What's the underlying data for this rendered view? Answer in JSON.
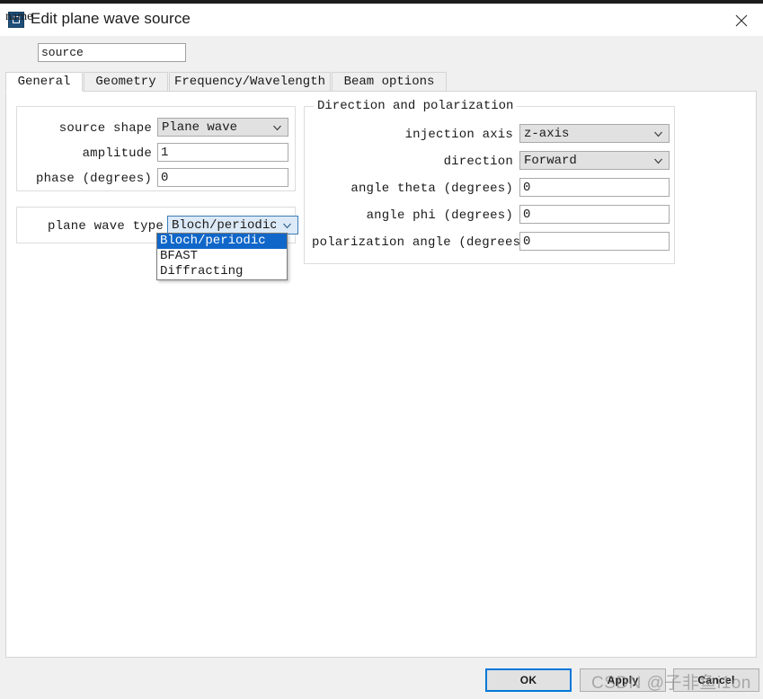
{
  "window": {
    "title": "Edit plane wave source",
    "icon": "app-window-icon",
    "close_icon": "close-icon"
  },
  "name_field": {
    "label": "name",
    "value": "source",
    "placeholder": ""
  },
  "tabs": [
    {
      "label": "General",
      "active": true
    },
    {
      "label": "Geometry",
      "active": false
    },
    {
      "label": "Frequency/Wavelength",
      "active": false
    },
    {
      "label": "Beam options",
      "active": false
    }
  ],
  "general": {
    "source_group": {
      "legend": "",
      "fields": [
        {
          "label": "source shape",
          "type": "combo",
          "value": "Plane wave"
        },
        {
          "label": "amplitude",
          "type": "text",
          "value": "1"
        },
        {
          "label": "phase (degrees)",
          "type": "text",
          "value": "0"
        }
      ]
    },
    "plane_wave_group": {
      "legend": "",
      "field": {
        "label": "plane wave type",
        "type": "combo",
        "value": "Bloch/periodic"
      },
      "dropdown": {
        "open": true,
        "options": [
          "Bloch/periodic",
          "BFAST",
          "Diffracting"
        ],
        "selected_index": 0
      }
    },
    "direction_group": {
      "legend": "Direction and polarization",
      "fields": [
        {
          "label": "injection axis",
          "type": "combo",
          "value": "z-axis"
        },
        {
          "label": "direction",
          "type": "combo",
          "value": "Forward"
        },
        {
          "label": "angle theta (degrees)",
          "type": "text",
          "value": "0"
        },
        {
          "label": "angle phi (degrees)",
          "type": "text",
          "value": "0"
        },
        {
          "label": "polarization angle (degrees)",
          "type": "text",
          "value": "0"
        }
      ]
    }
  },
  "footer": {
    "buttons": [
      {
        "label": "OK",
        "primary": true
      },
      {
        "label": "Apply",
        "primary": false
      },
      {
        "label": "Cancel",
        "primary": false
      }
    ]
  },
  "watermark": {
    "text": "CSDN @子非鱼i1on"
  },
  "colors": {
    "accent": "#0078d7",
    "selection": "#1067c9",
    "title_icon": "#1f4e79",
    "combo_bg": "#e1e1e1",
    "panel_bg": "#f0f0f0",
    "content_bg": "#ffffff"
  }
}
